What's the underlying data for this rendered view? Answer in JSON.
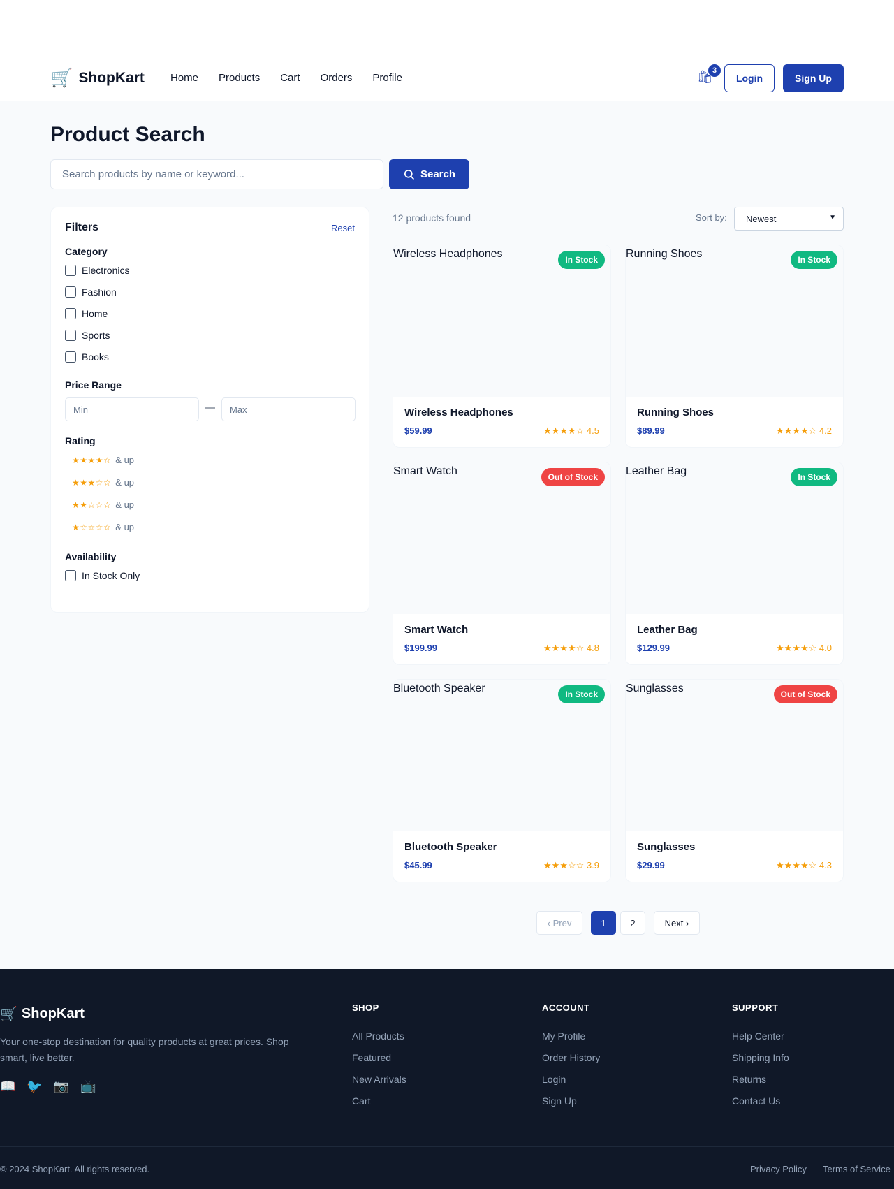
{
  "brand": {
    "name": "ShopKart",
    "logo_icon": "shopping-cart-icon"
  },
  "nav": {
    "items": [
      "Home",
      "Products",
      "Cart",
      "Orders",
      "Profile"
    ]
  },
  "header": {
    "cart_count": "3",
    "login_label": "Login",
    "signup_label": "Sign Up"
  },
  "search": {
    "title": "Product Search",
    "placeholder": "Search products by name or keyword...",
    "button_label": "Search"
  },
  "filters": {
    "title": "Filters",
    "reset_label": "Reset",
    "category": {
      "label": "Category",
      "options": [
        "Electronics",
        "Fashion",
        "Home",
        "Sports",
        "Books"
      ]
    },
    "price": {
      "label": "Price Range",
      "min_placeholder": "Min",
      "max_placeholder": "Max",
      "separator": "—"
    },
    "rating": {
      "label": "Rating",
      "options": [
        {
          "stars": "★★★★☆",
          "suffix": "& up"
        },
        {
          "stars": "★★★☆☆",
          "suffix": "& up"
        },
        {
          "stars": "★★☆☆☆",
          "suffix": "& up"
        },
        {
          "stars": "★☆☆☆☆",
          "suffix": "& up"
        }
      ]
    },
    "availability": {
      "label": "Availability",
      "option": "In Stock Only"
    }
  },
  "results": {
    "count_text": "12 products found",
    "sort_label": "Sort by:",
    "sort_value": "Newest"
  },
  "products": [
    {
      "name": "Wireless Headphones",
      "price": "$59.99",
      "stars": "★★★★☆",
      "rating": "4.5",
      "stock": "In Stock"
    },
    {
      "name": "Running Shoes",
      "price": "$89.99",
      "stars": "★★★★☆",
      "rating": "4.2",
      "stock": "In Stock"
    },
    {
      "name": "Smart Watch",
      "price": "$199.99",
      "stars": "★★★★☆",
      "rating": "4.8",
      "stock": "Out of Stock"
    },
    {
      "name": "Leather Bag",
      "price": "$129.99",
      "stars": "★★★★☆",
      "rating": "4.0",
      "stock": "In Stock"
    },
    {
      "name": "Bluetooth Speaker",
      "price": "$45.99",
      "stars": "★★★☆☆",
      "rating": "3.9",
      "stock": "In Stock"
    },
    {
      "name": "Sunglasses",
      "price": "$29.99",
      "stars": "★★★★☆",
      "rating": "4.3",
      "stock": "Out of Stock"
    }
  ],
  "pagination": {
    "prev": "‹ Prev",
    "pages": [
      "1",
      "2"
    ],
    "next": "Next ›",
    "current": "1"
  },
  "footer": {
    "desc": "Your one-stop destination for quality products at great prices. Shop smart, live better.",
    "social_icons": [
      "📖",
      "🐦",
      "📷",
      "📺"
    ],
    "columns": [
      {
        "title": "SHOP",
        "links": [
          "All Products",
          "Featured",
          "New Arrivals",
          "Cart"
        ]
      },
      {
        "title": "ACCOUNT",
        "links": [
          "My Profile",
          "Order History",
          "Login",
          "Sign Up"
        ]
      },
      {
        "title": "SUPPORT",
        "links": [
          "Help Center",
          "Shipping Info",
          "Returns",
          "Contact Us"
        ]
      }
    ],
    "copyright": "© 2024 ShopKart. All rights reserved.",
    "privacy": "Privacy Policy",
    "terms": "Terms of Service"
  },
  "colors": {
    "primary": "#1e40af",
    "in_stock": "#10b981",
    "out_of_stock": "#ef4444",
    "star": "#f59e0b",
    "footer_bg": "#101828"
  }
}
